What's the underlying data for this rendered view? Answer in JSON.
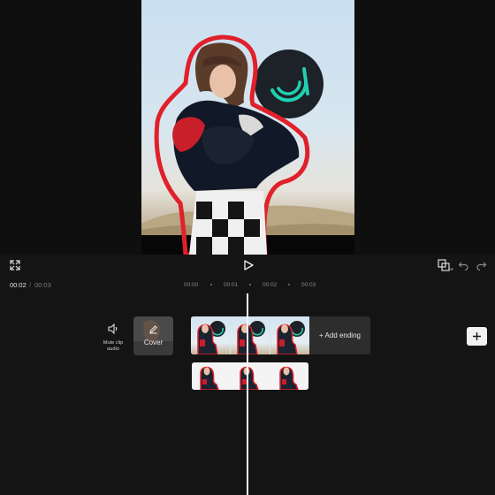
{
  "timeline": {
    "current_time": "00:02",
    "separator": "/",
    "total_time": "00:03",
    "ruler": [
      "00:00",
      "00:01",
      "00:02",
      "00:03"
    ]
  },
  "toolbar": {
    "fullscreen_icon": "expand-icon",
    "play_icon": "play-icon",
    "compare_icon": "compare-off-icon",
    "undo_icon": "undo-icon",
    "redo_icon": "redo-icon"
  },
  "tracks": {
    "mute_label": "Mute clip audio",
    "cover_label": "Cover",
    "add_ending_label": "+ Add ending",
    "add_track_icon": "plus-icon"
  },
  "colors": {
    "background": "#141414",
    "outline": "#e0202a",
    "brand_teal": "#20d0b0",
    "playhead": "#f5f5f5"
  }
}
